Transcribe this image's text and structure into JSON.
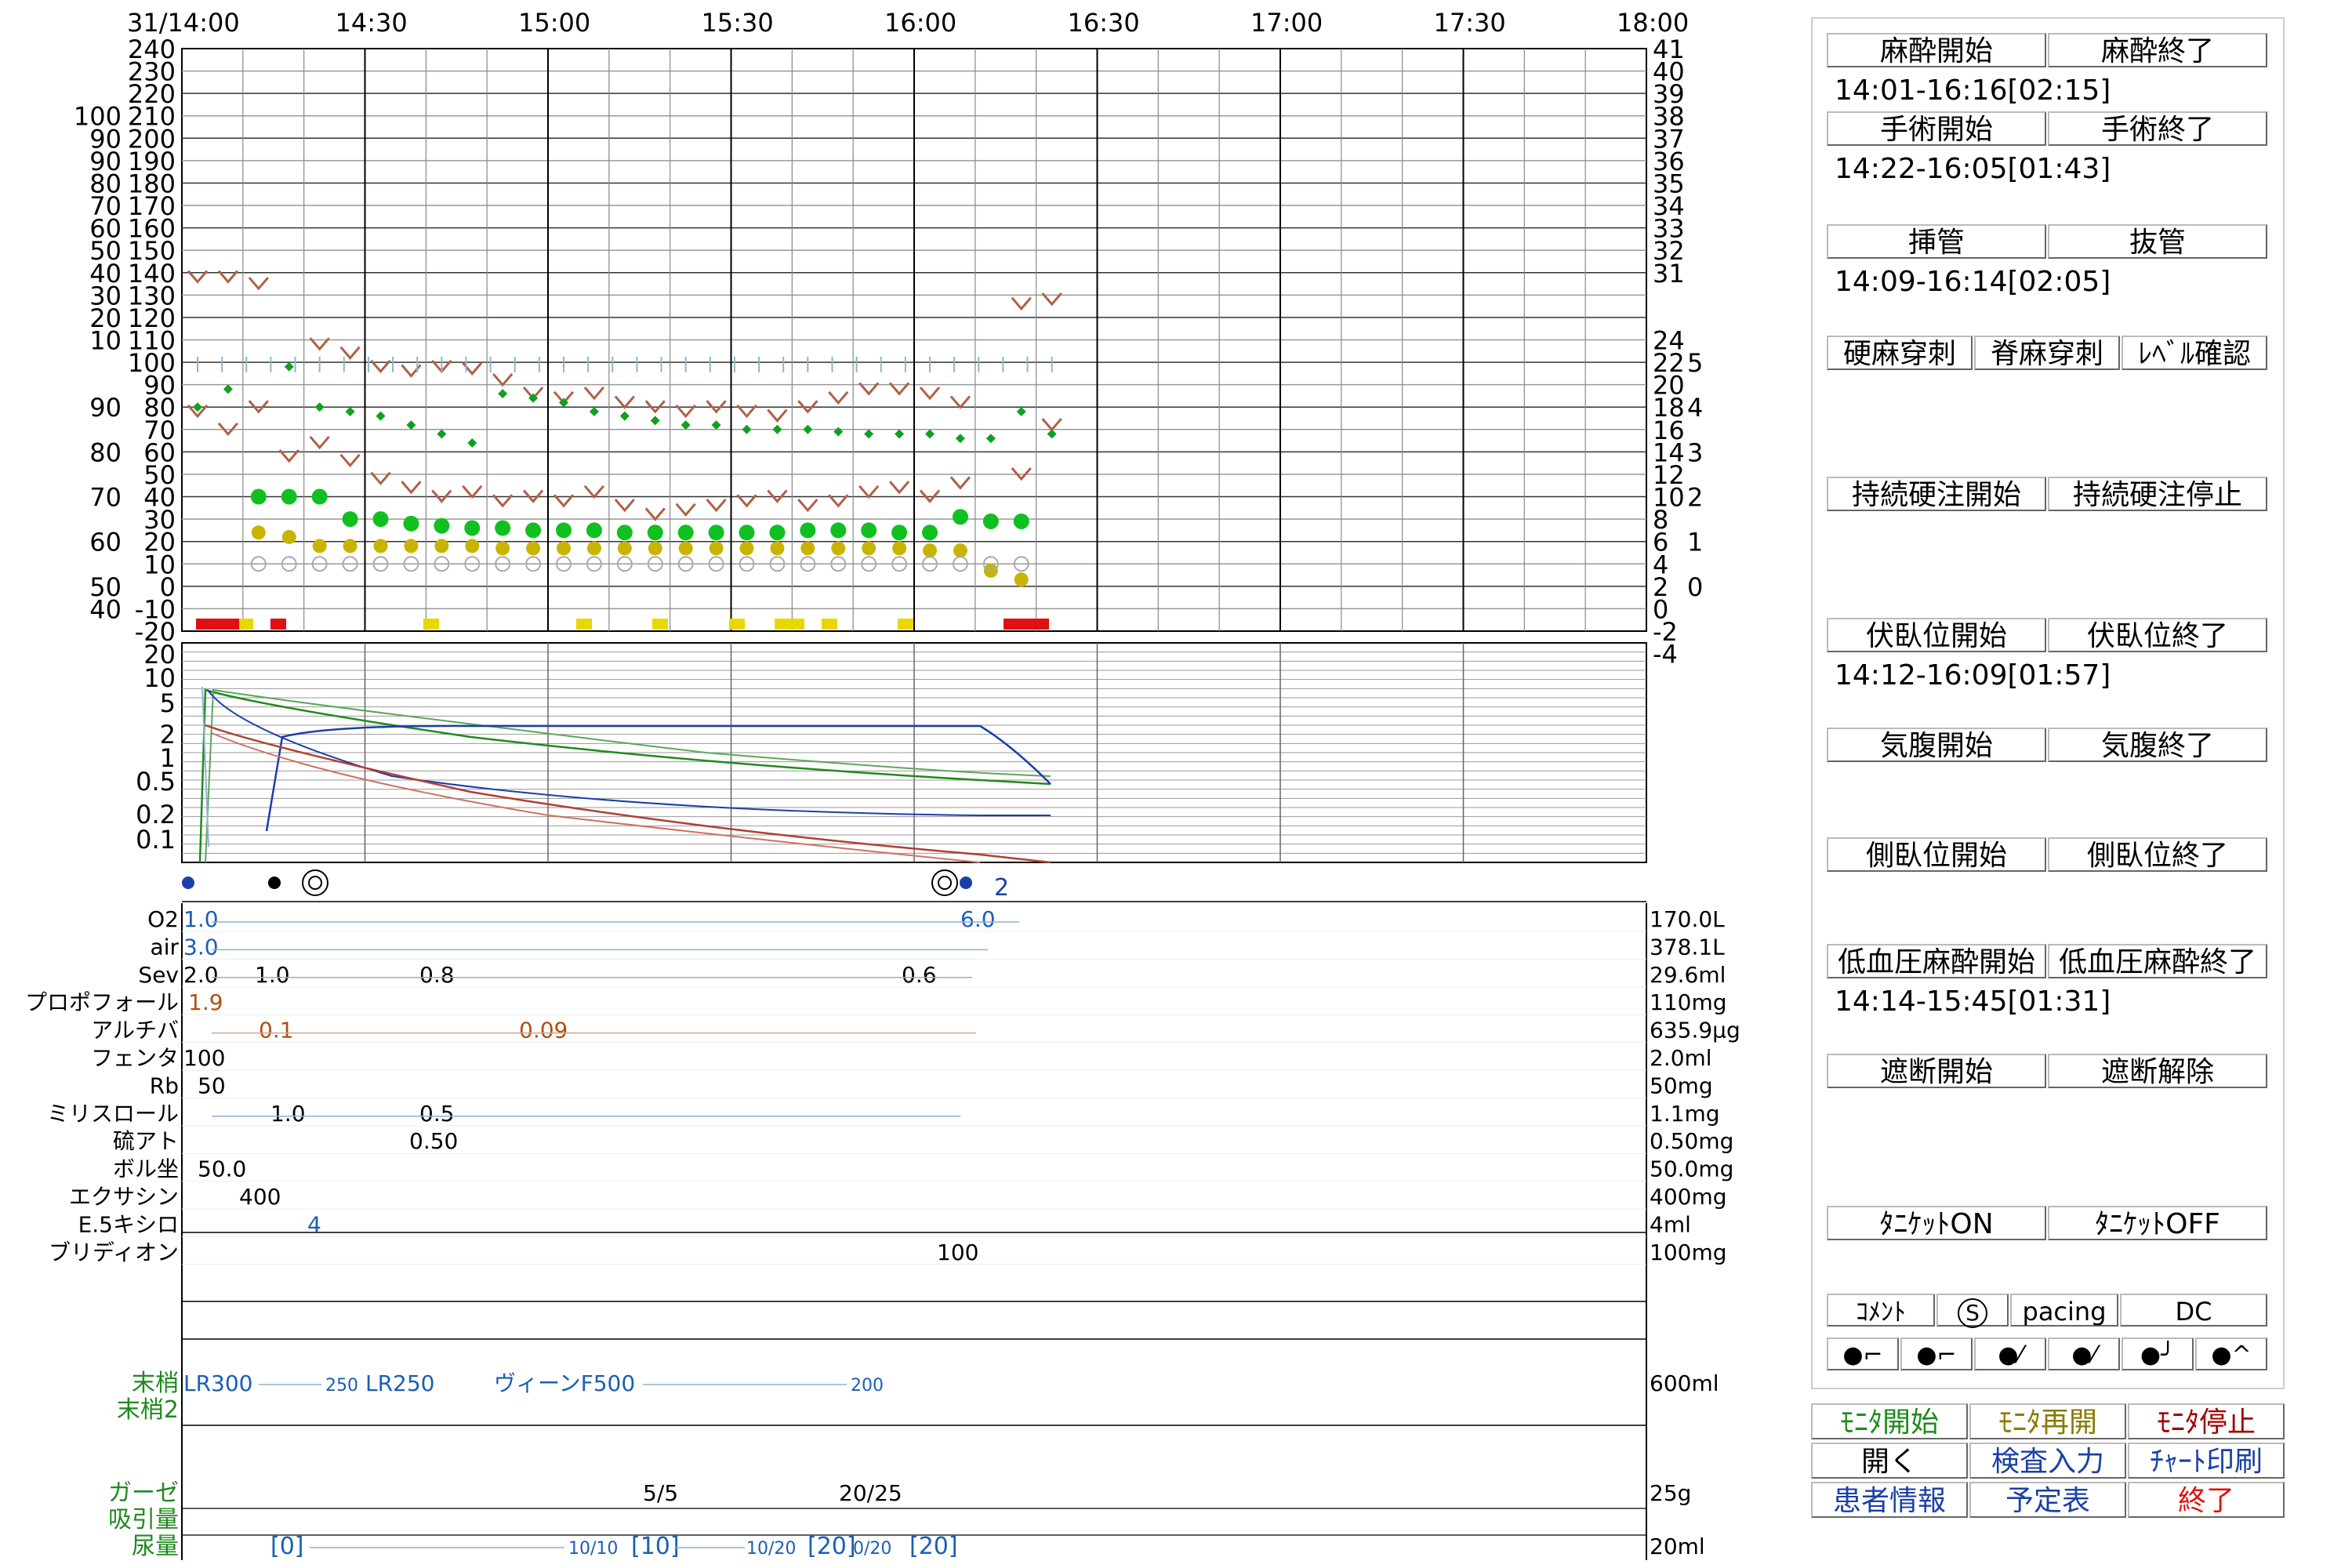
{
  "colors": {
    "bp": "#b06048",
    "hr": "#10a020",
    "spo2": "#10c020",
    "etco2": "#c8b400",
    "temp": "#8ab8c8",
    "blue": "#1a3fa8",
    "green": "#1f8a1f",
    "red": "#e01010",
    "yellow": "#e8d800",
    "drug_blue": "#1a5fb4",
    "drug_brown": "#b05010",
    "label_green": "#1f8a1f",
    "darkred": "#a00000"
  },
  "chart": {
    "time_labels": [
      "31/14:00",
      "14:30",
      "15:00",
      "15:30",
      "16:00",
      "16:30",
      "17:00",
      "17:30",
      "18:00"
    ],
    "y_left_outer": [
      "100",
      "90",
      "90",
      "80",
      "70",
      "60",
      "50",
      "40",
      "30",
      "20",
      "10",
      "",
      "90",
      "80",
      "70",
      "60",
      "50",
      "40"
    ],
    "y_left_inner": [
      "240",
      "230",
      "220",
      "210",
      "200",
      "190",
      "180",
      "170",
      "160",
      "150",
      "140",
      "130",
      "120",
      "110",
      "100",
      "90",
      "80",
      "70",
      "60",
      "50",
      "40",
      "30",
      "20",
      "10",
      "0",
      "-10",
      "-20"
    ],
    "y_right_1": [
      "41",
      "40",
      "39",
      "38",
      "37",
      "36",
      "35",
      "34",
      "33",
      "32",
      "31",
      "24",
      "22",
      "20",
      "18",
      "16",
      "14",
      "12",
      "10",
      "8",
      "6",
      "4",
      "2",
      "0",
      "-2",
      "-4"
    ],
    "y_right_2": [
      "5",
      "4",
      "3",
      "2",
      "1",
      "0"
    ],
    "log_labels": [
      "20",
      "10",
      "5",
      "2",
      "1",
      "0.5",
      "0.2",
      "0.1"
    ]
  },
  "chart_data": {
    "type": "line",
    "series": [
      {
        "name": "",
        "x": [
          "14:00",
          "14:10",
          "14:20",
          "14:30",
          "14:40",
          "14:50",
          "15:00",
          "15:10",
          "15:20",
          "15:30",
          "15:40",
          "15:50",
          "16:00",
          "16:10"
        ],
        "values": [
          135,
          138,
          110,
          100,
          95,
          85,
          80,
          75,
          78,
          72,
          80,
          85,
          90,
          130
        ]
      }
    ]
  },
  "drugs": [
    {
      "label": "O2",
      "values": [
        "1.0",
        "6.0"
      ],
      "total": "170.0L"
    },
    {
      "label": "air",
      "values": [
        "3.0"
      ],
      "total": "378.1L"
    },
    {
      "label": "Sev",
      "values": [
        "2.0",
        "1.0",
        "0.8",
        "0.6"
      ],
      "total": "29.6ml"
    },
    {
      "label": "プロポフォール",
      "values": [
        "1.9"
      ],
      "total": "110mg"
    },
    {
      "label": "アルチバ",
      "values": [
        "0.1",
        "0.09"
      ],
      "total": "635.9μg"
    },
    {
      "label": "フェンタ",
      "values": [
        "100"
      ],
      "total": "2.0ml"
    },
    {
      "label": "Rb",
      "values": [
        "50"
      ],
      "total": "50mg"
    },
    {
      "label": "ミリスロール",
      "values": [
        "1.0",
        "0.5"
      ],
      "total": "1.1mg"
    },
    {
      "label": "硫アト",
      "values": [
        "0.50"
      ],
      "total": "0.50mg"
    },
    {
      "label": "ボル坐",
      "values": [
        "50.0"
      ],
      "total": "50.0mg"
    },
    {
      "label": "エクサシン",
      "values": [
        "400"
      ],
      "total": "400mg"
    },
    {
      "label": "E.5キシロ",
      "values": [
        "4"
      ],
      "total": "4ml"
    },
    {
      "label": "ブリディオン",
      "values": [
        "100"
      ],
      "total": "100mg"
    }
  ],
  "fluids": {
    "line1_label": "末梢",
    "line2_label": "末梢2",
    "items": [
      "LR300",
      "250",
      "LR250",
      "ヴィーンF500",
      "200"
    ],
    "total": "600ml"
  },
  "outputs": {
    "gauze_label": "ガーゼ",
    "suction_label": "吸引量",
    "urine_label": "尿量",
    "gauze": [
      "5/5",
      "20/25"
    ],
    "gauze_total": "25g",
    "urine": [
      "[0]",
      "10/10",
      "[10]",
      "10/20",
      "[20]",
      "0/20",
      "[20]"
    ],
    "urine_total": "20ml"
  },
  "events": {
    "mark_2": "2"
  },
  "panel": {
    "anesthesia_start": "麻酔開始",
    "anesthesia_end": "麻酔終了",
    "anesthesia_time": "14:01-16:16[02:15]",
    "surgery_start": "手術開始",
    "surgery_end": "手術終了",
    "surgery_time": "14:22-16:05[01:43]",
    "intubation": "挿管",
    "extubation": "抜管",
    "intubation_time": "14:09-16:14[02:05]",
    "epidural_puncture": "硬麻穿刺",
    "spinal_puncture": "脊麻穿刺",
    "level_check": "ﾚﾍﾞﾙ確認",
    "cont_epi_start": "持続硬注開始",
    "cont_epi_stop": "持続硬注停止",
    "prone_start": "伏臥位開始",
    "prone_end": "伏臥位終了",
    "prone_time": "14:12-16:09[01:57]",
    "pneumo_start": "気腹開始",
    "pneumo_end": "気腹終了",
    "lateral_start": "側臥位開始",
    "lateral_end": "側臥位終了",
    "hypo_start": "低血圧麻酔開始",
    "hypo_end": "低血圧麻酔終了",
    "hypo_time": "14:14-15:45[01:31]",
    "block_start": "遮断開始",
    "block_release": "遮断解除",
    "tourniquet_on": "ﾀﾆｹｯﾄON",
    "tourniquet_off": "ﾀﾆｹｯﾄOFF",
    "comment": "ｺﾒﾝﾄ",
    "s_mark": "S",
    "pacing": "pacing",
    "dc": "DC"
  },
  "bottom": {
    "monitor_start": "ﾓﾆﾀ開始",
    "monitor_resume": "ﾓﾆﾀ再開",
    "monitor_stop": "ﾓﾆﾀ停止",
    "open": "開く",
    "exam_input": "検査入力",
    "chart_print": "ﾁｬｰﾄ印刷",
    "patient_info": "患者情報",
    "schedule": "予定表",
    "exit": "終了"
  }
}
